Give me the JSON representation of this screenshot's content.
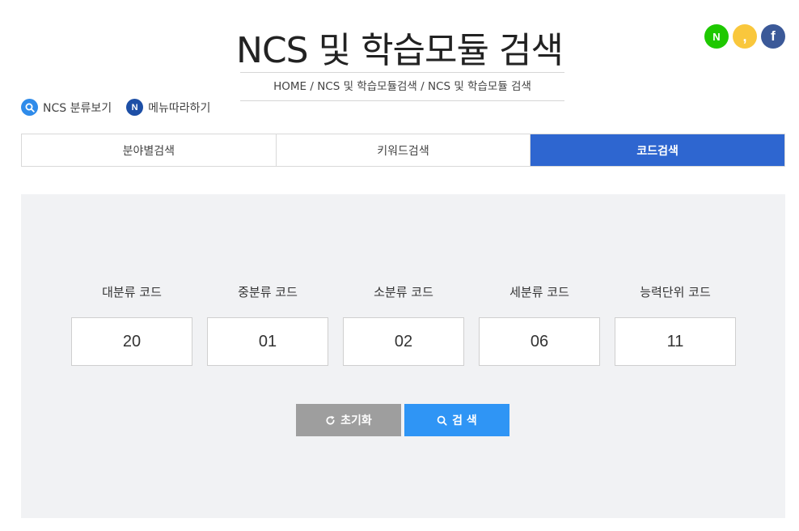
{
  "page": {
    "title": "NCS 및 학습모듈 검색",
    "breadcrumb": "HOME / NCS 및 학습모듈검색 / NCS 및 학습모듈 검색"
  },
  "social": {
    "naver_glyph": "N",
    "kakao_glyph": ",",
    "facebook_glyph": "f",
    "colors": {
      "naver": "#1ec800",
      "kakao": "#f9c73c",
      "facebook": "#3b5998"
    }
  },
  "quicklinks": [
    {
      "label": "NCS 분류보기",
      "icon": "search-icon"
    },
    {
      "label": "메뉴따라하기",
      "icon": "n-badge-icon",
      "glyph": "N"
    }
  ],
  "tabs": [
    {
      "label": "분야별검색",
      "active": false
    },
    {
      "label": "키워드검색",
      "active": false
    },
    {
      "label": "코드검색",
      "active": true
    }
  ],
  "codes": [
    {
      "label": "대분류 코드",
      "value": "20"
    },
    {
      "label": "중분류 코드",
      "value": "01"
    },
    {
      "label": "소분류 코드",
      "value": "02"
    },
    {
      "label": "세분류 코드",
      "value": "06"
    },
    {
      "label": "능력단위 코드",
      "value": "11"
    }
  ],
  "actions": {
    "reset_label": "초기화",
    "search_label": "검 색"
  },
  "colors": {
    "accent": "#2e66d0",
    "search_button": "#2f95f5",
    "reset_button": "#9e9e9e",
    "panel_bg": "#f1f2f4"
  }
}
